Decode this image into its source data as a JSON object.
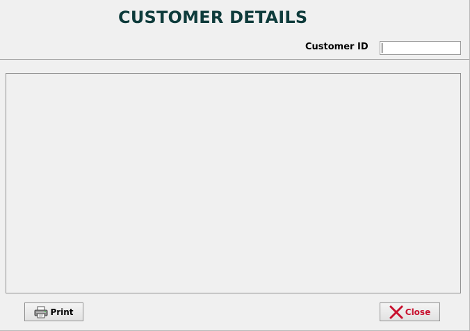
{
  "header": {
    "title": "CUSTOMER DETAILS"
  },
  "form": {
    "customer_id_label": "Customer ID",
    "customer_id_value": ""
  },
  "buttons": {
    "print_label": "Print",
    "close_label": "Close"
  },
  "icons": {
    "print": "printer-icon",
    "close": "red-x-icon"
  },
  "colors": {
    "title": "#0e3b3b",
    "close_text": "#c8102e",
    "background": "#f0f0f0"
  }
}
